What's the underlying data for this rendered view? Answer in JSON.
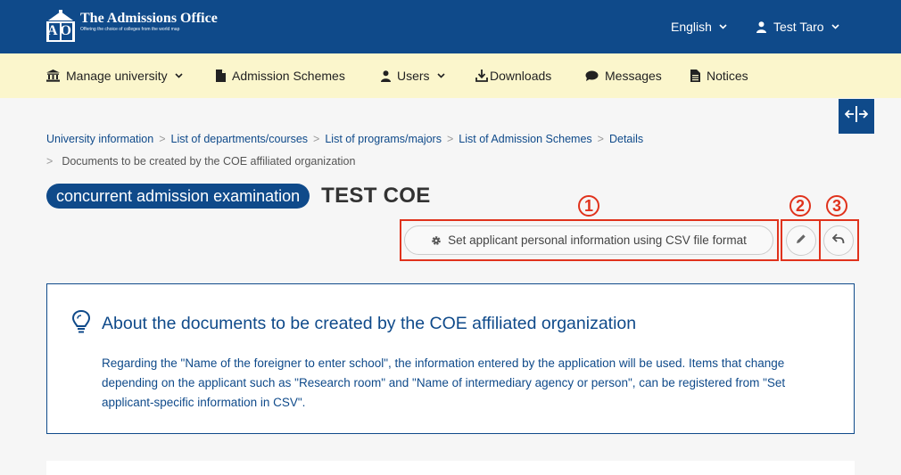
{
  "header": {
    "logo_title": "The Admissions Office",
    "logo_subtitle": "Offering the choice of colleges from the world map",
    "logo_mark_letters": "AO",
    "language": "English",
    "user_name": "Test Taro"
  },
  "nav": {
    "items": [
      {
        "label": "Manage university",
        "icon": "university-icon",
        "dropdown": true
      },
      {
        "label": "Admission Schemes",
        "icon": "document-icon",
        "dropdown": false
      },
      {
        "label": "Users",
        "icon": "user-icon",
        "dropdown": true
      },
      {
        "label": "Downloads",
        "icon": "download-icon",
        "dropdown": false
      },
      {
        "label": "Messages",
        "icon": "chat-icon",
        "dropdown": false
      },
      {
        "label": "Notices",
        "icon": "notice-icon",
        "dropdown": false
      }
    ]
  },
  "breadcrumb": {
    "items": [
      "University information",
      "List of departments/courses",
      "List of programs/majors",
      "List of Admission Schemes",
      "Details"
    ],
    "current": "Documents to be created by the COE affiliated organization",
    "separator": ">"
  },
  "title": {
    "badge": "concurrent admission examination",
    "main": "TEST COE"
  },
  "annotations": {
    "n1": "1",
    "n2": "2",
    "n3": "3",
    "color": "#e0321c"
  },
  "actions": {
    "csv_button": "Set applicant personal information using CSV file format",
    "edit_icon": "pencil-icon",
    "back_icon": "reply-icon"
  },
  "info": {
    "title": "About the documents to be created by the COE affiliated organization",
    "body": "Regarding the \"Name of the foreigner to enter school\", the information entered by the application will be used. Items that change depending on the applicant such as \"Research room\" and \"Name of intermediary agency or person\", can be registered from \"Set applicant-specific information in CSV\".",
    "icon": "lightbulb-icon"
  },
  "colors": {
    "brand": "#0f4a8a",
    "nav_bg": "#fbf6cc",
    "page_bg": "#f6f6f6"
  }
}
